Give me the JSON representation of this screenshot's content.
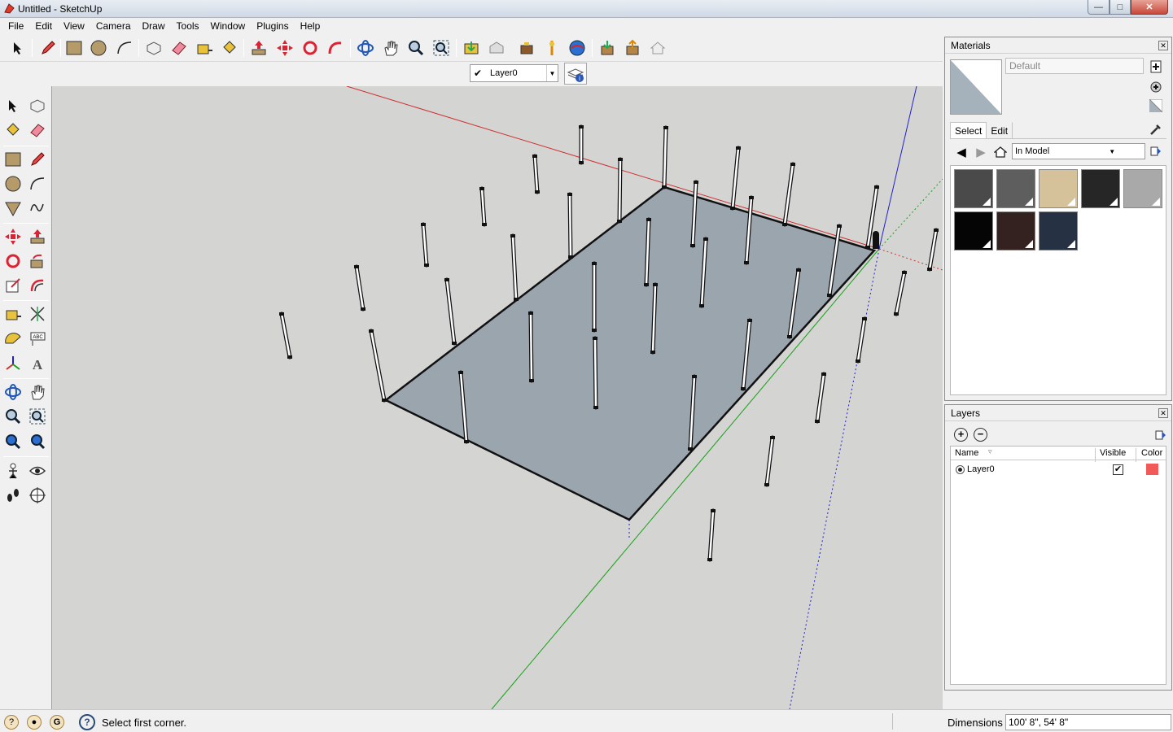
{
  "window": {
    "title": "Untitled - SketchUp"
  },
  "menu": [
    "File",
    "Edit",
    "View",
    "Camera",
    "Draw",
    "Tools",
    "Window",
    "Plugins",
    "Help"
  ],
  "layer_toolbar": {
    "current_layer": "Layer0"
  },
  "materials_panel": {
    "title": "Materials",
    "material_name": "Default",
    "tabs": [
      "Select",
      "Edit"
    ],
    "collection": "In Model",
    "swatch_colors": [
      "#4a4a4a",
      "#5e5e5e",
      "#d5c19a",
      "#262626",
      "#a9a9a9",
      "#050505",
      "#33221f",
      "#263143"
    ]
  },
  "layers_panel": {
    "title": "Layers",
    "columns": [
      "Name",
      "Visible",
      "Color"
    ],
    "rows": [
      {
        "name": "Layer0",
        "visible": true,
        "color": "#f25a5a"
      }
    ]
  },
  "status": {
    "message": "Select first corner.",
    "dimensions_label": "Dimensions",
    "dimensions_value": "100' 8\", 54' 8\""
  },
  "colors": {
    "viewport_bg": "#d4d4d2",
    "face": "#9aa5ae",
    "axis_red": "#d03030",
    "axis_green": "#18a018",
    "axis_blue": "#2020d0"
  }
}
